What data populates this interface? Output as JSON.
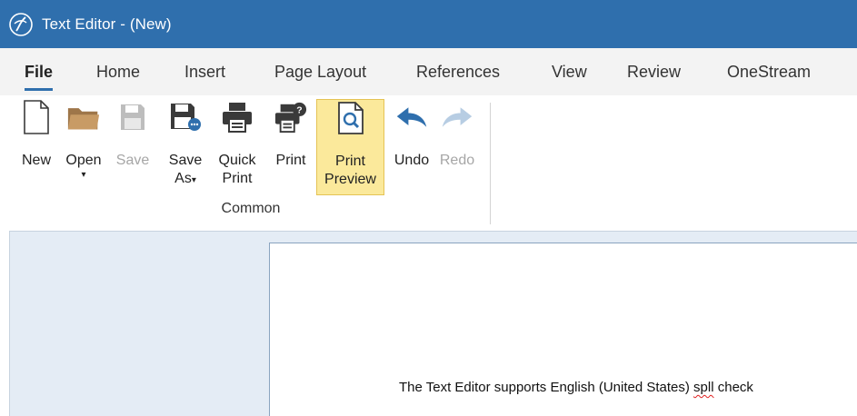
{
  "window": {
    "title": "Text Editor - (New)"
  },
  "tabs": [
    {
      "label": "File",
      "active": true
    },
    {
      "label": "Home"
    },
    {
      "label": "Insert"
    },
    {
      "label": "Page Layout"
    },
    {
      "label": "References"
    },
    {
      "label": "View"
    },
    {
      "label": "Review"
    },
    {
      "label": "OneStream"
    }
  ],
  "ribbon": {
    "group_label": "Common",
    "buttons": {
      "new": {
        "line1": "New",
        "icon": "new-document-icon"
      },
      "open": {
        "line1": "Open",
        "caret": "▾",
        "icon": "folder-icon"
      },
      "save": {
        "line1": "Save",
        "icon": "save-icon",
        "disabled": true
      },
      "save_as": {
        "line1": "Save",
        "line2": "As",
        "caret": "▾",
        "icon": "save-as-icon"
      },
      "quick_print": {
        "line1": "Quick",
        "line2": "Print",
        "icon": "printer-icon"
      },
      "print": {
        "line1": "Print",
        "icon": "print-dialog-icon"
      },
      "print_preview": {
        "line1": "Print",
        "line2": "Preview",
        "icon": "print-preview-icon",
        "highlighted": true
      },
      "undo": {
        "line1": "Undo",
        "icon": "undo-icon"
      },
      "redo": {
        "line1": "Redo",
        "icon": "redo-icon",
        "disabled": true
      }
    }
  },
  "document": {
    "text_before": "The Text Editor supports English (United States) ",
    "misspelled_word": "spll",
    "text_after": " check"
  },
  "colors": {
    "titlebar": "#2f6fad",
    "tab_underline": "#2f6fad",
    "highlight_fill": "#fbe99b",
    "canvas": "#e4ecf5",
    "icon_dark": "#3a3a3a",
    "folder": "#c89b65",
    "undo_blue": "#2f6fad",
    "disabled": "#a6a6a6"
  }
}
